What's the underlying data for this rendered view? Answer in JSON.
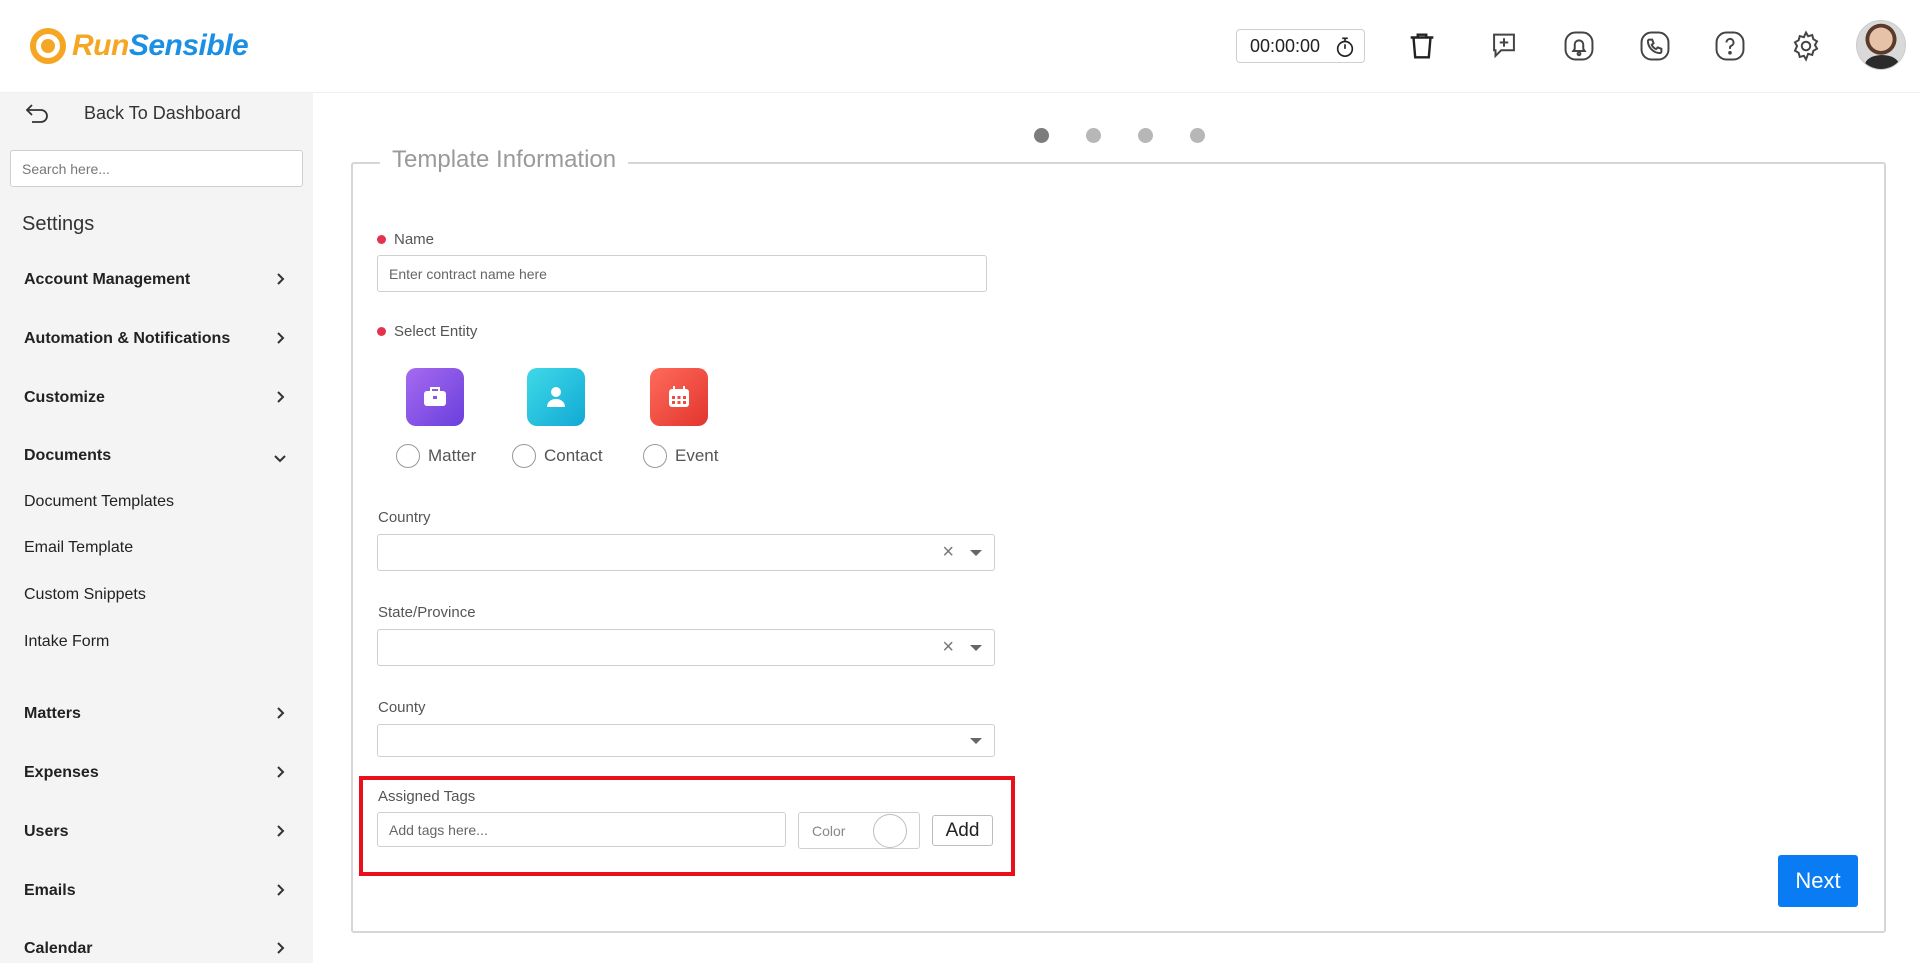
{
  "header": {
    "logo_run": "Run",
    "logo_sensible": "Sensible",
    "timer": "00:00:00",
    "icons": [
      "stopwatch-icon",
      "trash-icon",
      "add-task-icon",
      "bell-icon",
      "phone-icon",
      "help-icon",
      "gear-icon"
    ]
  },
  "sidebar": {
    "back_label": "Back To Dashboard",
    "search_placeholder": "Search here...",
    "section_title": "Settings",
    "items": [
      {
        "label": "Account Management"
      },
      {
        "label": "Automation & Notifications"
      },
      {
        "label": "Customize"
      },
      {
        "label": "Documents"
      },
      {
        "label": "Matters"
      },
      {
        "label": "Expenses"
      },
      {
        "label": "Users"
      },
      {
        "label": "Emails"
      },
      {
        "label": "Calendar"
      }
    ],
    "documents_sub": [
      {
        "label": "Document Templates"
      },
      {
        "label": "Email Template"
      },
      {
        "label": "Custom Snippets"
      },
      {
        "label": "Intake Form"
      }
    ]
  },
  "wizard": {
    "steps": 4,
    "active_step": 1
  },
  "form": {
    "legend": "Template Information",
    "name_label": "Name",
    "name_placeholder": "Enter contract name here",
    "entity_label": "Select Entity",
    "entities": [
      {
        "label": "Matter",
        "icon": "briefcase-icon",
        "color": "#8b55e8"
      },
      {
        "label": "Contact",
        "icon": "person-icon",
        "color": "#1fbfe0"
      },
      {
        "label": "Event",
        "icon": "calendar-icon",
        "color": "#f04a3c"
      }
    ],
    "country_label": "Country",
    "state_label": "State/Province",
    "county_label": "County",
    "tags_label": "Assigned Tags",
    "tags_placeholder": "Add tags here...",
    "color_label": "Color",
    "add_label": "Add",
    "next_label": "Next"
  },
  "colors": {
    "accent": "#0a7cf3",
    "highlight": "#e8101a",
    "required": "#e3334f"
  }
}
